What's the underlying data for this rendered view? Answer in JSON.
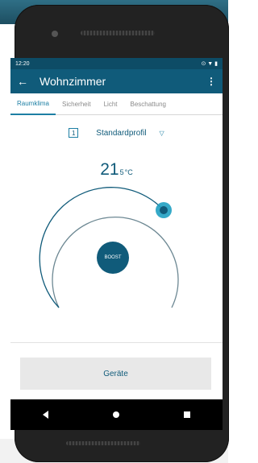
{
  "status_bar": {
    "time": "12:20",
    "icons": "⊙ ▼ ▮"
  },
  "app_bar": {
    "back_icon": "arrow-left-icon",
    "title": "Wohnzimmer",
    "menu_icon": "more-vert-icon"
  },
  "tabs": [
    {
      "label": "Raumklima",
      "active": true
    },
    {
      "label": "Sicherheit",
      "active": false
    },
    {
      "label": "Licht",
      "active": false
    },
    {
      "label": "Beschattung",
      "active": false
    }
  ],
  "profile": {
    "number": "1",
    "name": "Standardprofil",
    "dropdown_icon": "chevron-down-icon"
  },
  "temperature": {
    "main": "21",
    "decimal": "5",
    "unit": "°C"
  },
  "dial": {
    "boost_label": "BOOST"
  },
  "bottom_button": {
    "label": "Geräte"
  },
  "colors": {
    "primary": "#105b7a",
    "accent": "#1d7fa4",
    "status_bar": "#0d4c66",
    "knob": "#1fa0c2"
  }
}
